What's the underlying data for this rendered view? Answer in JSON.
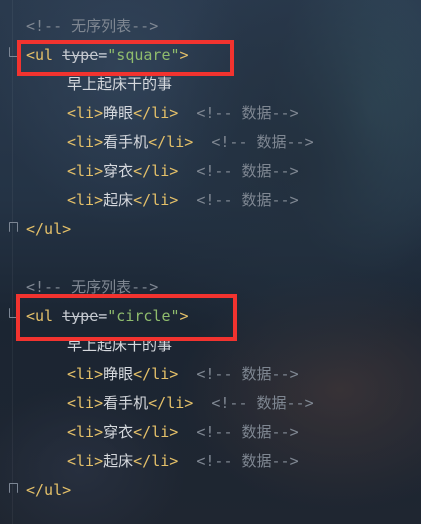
{
  "editor": {
    "colors": {
      "tag": "#e4c069",
      "comment": "#7f8792",
      "string": "#8fbc6d",
      "text": "#d6d9de",
      "highlight": "#f2332f"
    },
    "block1": {
      "comment": "<!-- 无序列表-->",
      "open_tag_start": "<ul",
      "attr_name": "type",
      "equals": "=",
      "attr_value": "\"square\"",
      "open_tag_end": ">",
      "text": "早上起床干的事",
      "items": [
        {
          "open": "<li>",
          "text": "睁眼",
          "close": "</li>",
          "comment": "<!-- 数据-->"
        },
        {
          "open": "<li>",
          "text": "看手机",
          "close": "</li>",
          "comment": "<!-- 数据-->"
        },
        {
          "open": "<li>",
          "text": "穿衣",
          "close": "</li>",
          "comment": "<!-- 数据-->"
        },
        {
          "open": "<li>",
          "text": "起床",
          "close": "</li>",
          "comment": "<!-- 数据-->"
        }
      ],
      "close_tag": "</ul>"
    },
    "block2": {
      "comment": "<!-- 无序列表-->",
      "open_tag_start": "<ul",
      "attr_name": "type",
      "equals": "=",
      "attr_value": "\"circle\"",
      "open_tag_end": ">",
      "text": "早上起床干的事",
      "items": [
        {
          "open": "<li>",
          "text": "睁眼",
          "close": "</li>",
          "comment": "<!-- 数据-->"
        },
        {
          "open": "<li>",
          "text": "看手机",
          "close": "</li>",
          "comment": "<!-- 数据-->"
        },
        {
          "open": "<li>",
          "text": "穿衣",
          "close": "</li>",
          "comment": "<!-- 数据-->"
        },
        {
          "open": "<li>",
          "text": "起床",
          "close": "</li>",
          "comment": "<!-- 数据-->"
        }
      ],
      "close_tag": "</ul>"
    }
  }
}
